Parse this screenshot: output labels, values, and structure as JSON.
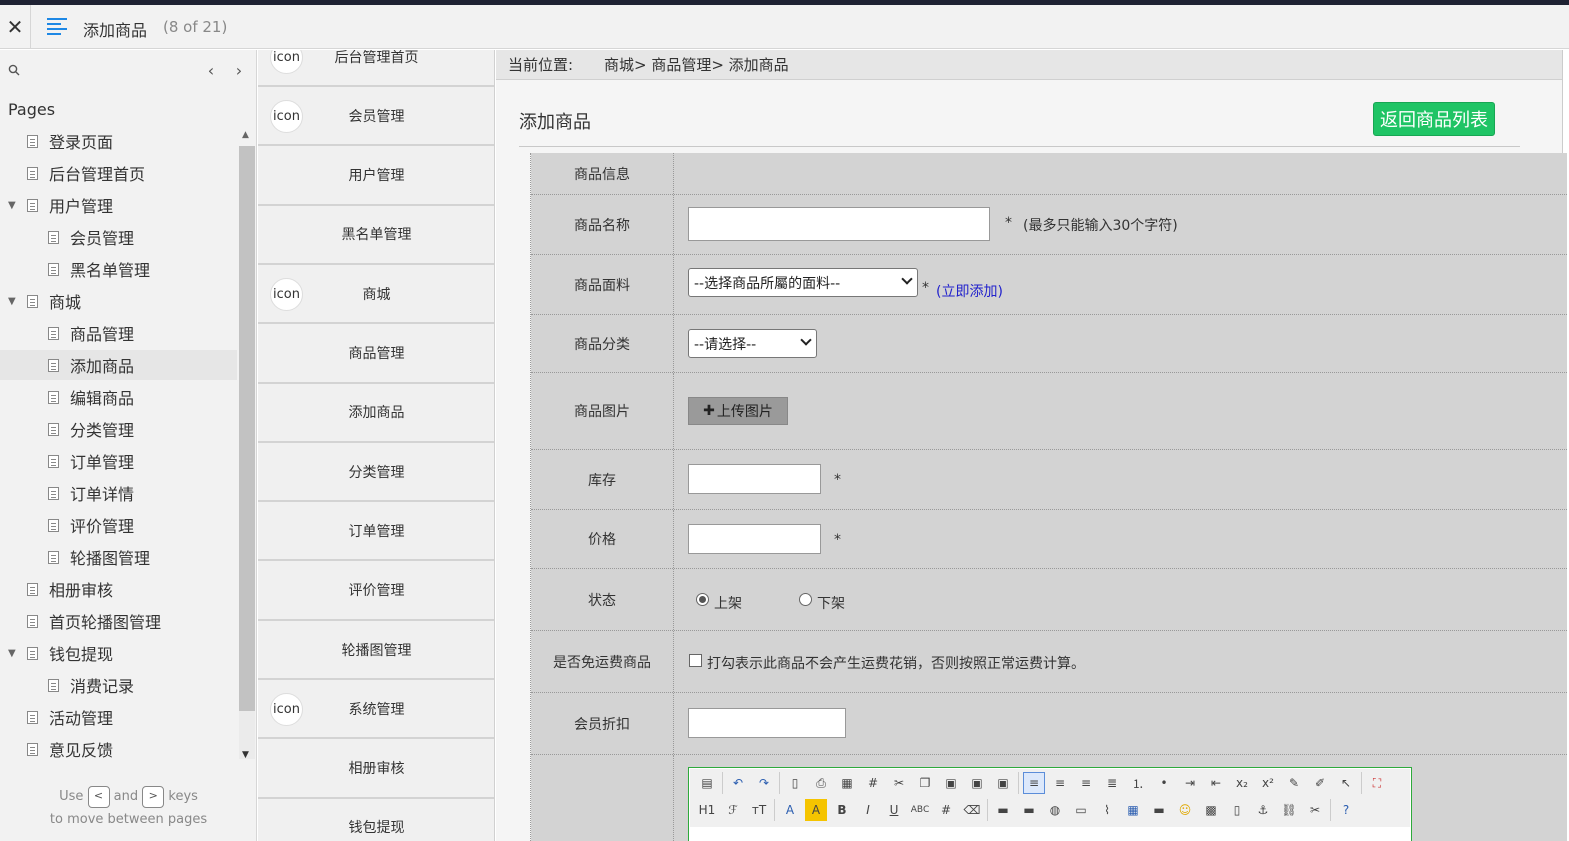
{
  "header": {
    "close_glyph": "✕",
    "title": "添加商品",
    "count": "(8 of 21)"
  },
  "sidebar": {
    "search_icon": "search-icon",
    "prev_glyph": "‹",
    "next_glyph": "›",
    "heading": "Pages",
    "items": [
      {
        "label": "登录页面",
        "level": 0,
        "expandable": false,
        "active": false
      },
      {
        "label": "后台管理首页",
        "level": 0,
        "expandable": false,
        "active": false
      },
      {
        "label": "用户管理",
        "level": 0,
        "expandable": true,
        "active": false
      },
      {
        "label": "会员管理",
        "level": 1,
        "expandable": false,
        "active": false
      },
      {
        "label": "黑名单管理",
        "level": 1,
        "expandable": false,
        "active": false
      },
      {
        "label": "商城",
        "level": 0,
        "expandable": true,
        "active": false
      },
      {
        "label": "商品管理",
        "level": 1,
        "expandable": false,
        "active": false
      },
      {
        "label": "添加商品",
        "level": 1,
        "expandable": false,
        "active": true
      },
      {
        "label": "编辑商品",
        "level": 1,
        "expandable": false,
        "active": false
      },
      {
        "label": "分类管理",
        "level": 1,
        "expandable": false,
        "active": false
      },
      {
        "label": "订单管理",
        "level": 1,
        "expandable": false,
        "active": false
      },
      {
        "label": "订单详情",
        "level": 1,
        "expandable": false,
        "active": false
      },
      {
        "label": "评价管理",
        "level": 1,
        "expandable": false,
        "active": false
      },
      {
        "label": "轮播图管理",
        "level": 1,
        "expandable": false,
        "active": false
      },
      {
        "label": "相册审核",
        "level": 0,
        "expandable": false,
        "active": false
      },
      {
        "label": "首页轮播图管理",
        "level": 0,
        "expandable": false,
        "active": false
      },
      {
        "label": "钱包提现",
        "level": 0,
        "expandable": true,
        "active": false
      },
      {
        "label": "消费记录",
        "level": 1,
        "expandable": false,
        "active": false
      },
      {
        "label": "活动管理",
        "level": 0,
        "expandable": false,
        "active": false
      },
      {
        "label": "意见反馈",
        "level": 0,
        "expandable": false,
        "active": false
      }
    ],
    "hint_use": "Use",
    "hint_and": "and",
    "hint_keys": "keys",
    "hint_line2": "to move between pages",
    "key_prev": "<",
    "key_next": ">"
  },
  "appnav": {
    "items": [
      {
        "label": "后台管理首页",
        "icon": "icon"
      },
      {
        "label": "会员管理",
        "icon": "icon"
      },
      {
        "label": "用户管理",
        "icon": ""
      },
      {
        "label": "黑名单管理",
        "icon": ""
      },
      {
        "label": "商城",
        "icon": "icon"
      },
      {
        "label": "商品管理",
        "icon": ""
      },
      {
        "label": "添加商品",
        "icon": ""
      },
      {
        "label": "分类管理",
        "icon": ""
      },
      {
        "label": "订单管理",
        "icon": ""
      },
      {
        "label": "评价管理",
        "icon": ""
      },
      {
        "label": "轮播图管理",
        "icon": ""
      },
      {
        "label": "系统管理",
        "icon": "icon"
      },
      {
        "label": "相册审核",
        "icon": ""
      },
      {
        "label": "钱包提现",
        "icon": ""
      }
    ]
  },
  "main": {
    "crumb_label": "当前位置:",
    "crumb_path": "商城> 商品管理> 添加商品",
    "title": "添加商品",
    "back_button": "返回商品列表",
    "accent_color": "#1fc465",
    "form": {
      "section_header": "商品信息",
      "name_label": "商品名称",
      "name_value": "",
      "name_required": "*",
      "name_note": "(最多只能输入30个字符)",
      "fabric_label": "商品面料",
      "fabric_select": "--选择商品所屬的面料--",
      "fabric_required": "*",
      "fabric_link": "(立即添加)",
      "category_label": "商品分类",
      "category_select": "--请选择--",
      "image_label": "商品图片",
      "upload_button": "上传图片",
      "stock_label": "库存",
      "stock_value": "",
      "stock_required": "*",
      "price_label": "价格",
      "price_value": "",
      "price_required": "*",
      "status_label": "状态",
      "status_on": "上架",
      "status_off": "下架",
      "status_selected": "上架",
      "freeship_label": "是否免运费商品",
      "freeship_note": "打勾表示此商品不会产生运费花销，否则按照正常运费计算。",
      "freeship_checked": false,
      "discount_label": "会员折扣",
      "discount_value": ""
    }
  }
}
